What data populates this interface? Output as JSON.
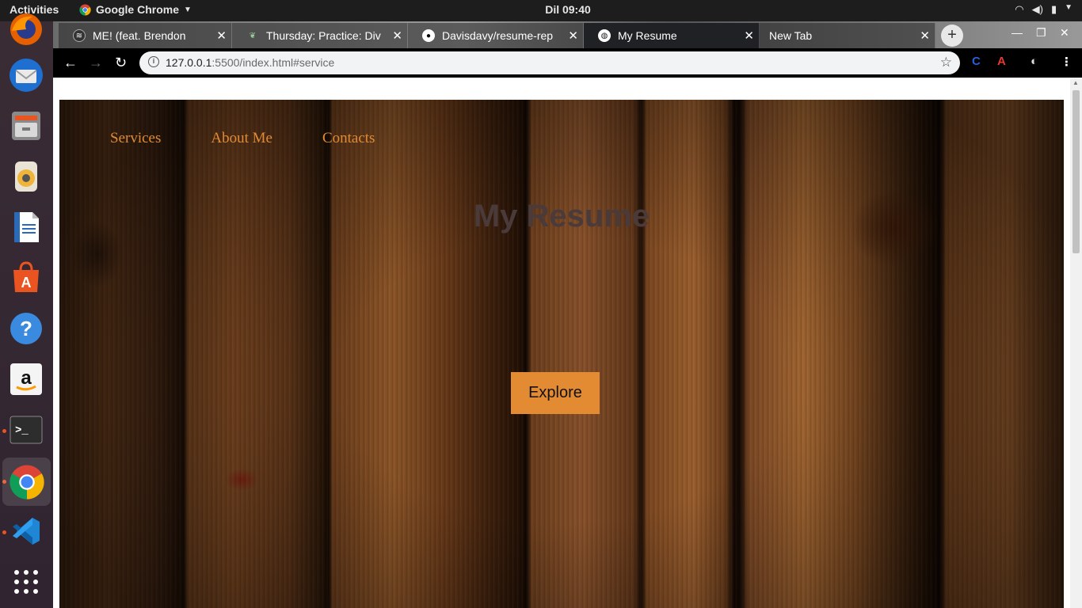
{
  "topbar": {
    "activities": "Activities",
    "app_name": "Google Chrome",
    "clock": "Dil 09:40"
  },
  "dock": {
    "items": [
      "firefox-icon",
      "thunderbird-icon",
      "files-icon",
      "rhythmbox-icon",
      "writer-icon",
      "software-center-icon",
      "help-icon",
      "amazon-icon",
      "terminal-icon",
      "chrome-icon",
      "vscode-icon",
      "show-apps-icon"
    ]
  },
  "browser": {
    "tabs": [
      {
        "title": "ME! (feat. Brendon",
        "icon": "spotify-icon"
      },
      {
        "title": "Thursday: Practice: Div",
        "icon": "leaf-icon"
      },
      {
        "title": "Davisdavy/resume-rep",
        "icon": "github-icon"
      },
      {
        "title": "My Resume",
        "icon": "globe-icon",
        "active": true
      },
      {
        "title": "New Tab",
        "icon": ""
      }
    ],
    "url_host": "127.0.0.1",
    "url_rest": ":5500/index.html#service"
  },
  "page": {
    "nav": [
      "Services",
      "About Me",
      "Contacts"
    ],
    "title": "My Resume",
    "explore_label": "Explore"
  },
  "colors": {
    "accent": "#e38b32",
    "nav_link": "#e08b35",
    "title": "#4a3b3a"
  }
}
